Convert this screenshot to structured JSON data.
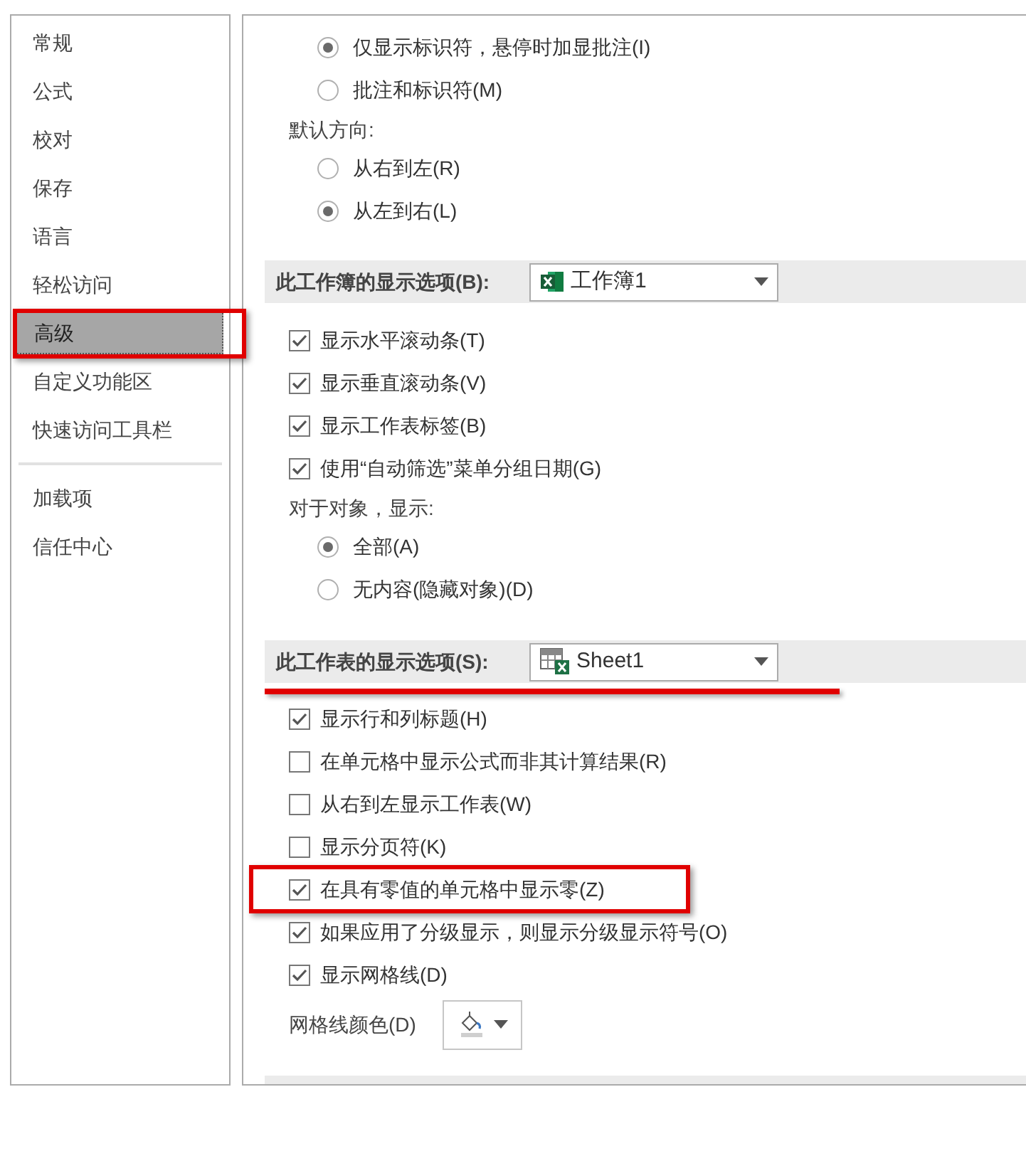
{
  "sidebar": {
    "items": [
      {
        "kind": "item",
        "label": "常规",
        "selected": false,
        "highlighted": false
      },
      {
        "kind": "item",
        "label": "公式",
        "selected": false,
        "highlighted": false
      },
      {
        "kind": "item",
        "label": "校对",
        "selected": false,
        "highlighted": false
      },
      {
        "kind": "item",
        "label": "保存",
        "selected": false,
        "highlighted": false
      },
      {
        "kind": "item",
        "label": "语言",
        "selected": false,
        "highlighted": false
      },
      {
        "kind": "item",
        "label": "轻松访问",
        "selected": false,
        "highlighted": false
      },
      {
        "kind": "item",
        "label": "高级",
        "selected": true,
        "highlighted": true
      },
      {
        "kind": "item",
        "label": "自定义功能区",
        "selected": false,
        "highlighted": false
      },
      {
        "kind": "item",
        "label": "快速访问工具栏",
        "selected": false,
        "highlighted": false
      },
      {
        "kind": "separator"
      },
      {
        "kind": "item",
        "label": "加载项",
        "selected": false,
        "highlighted": false
      },
      {
        "kind": "item",
        "label": "信任中心",
        "selected": false,
        "highlighted": false
      }
    ]
  },
  "content": [
    {
      "kind": "radio",
      "label": "仅显示标识符，悬停时加显批注(I)",
      "selected": true
    },
    {
      "kind": "radio",
      "label": "批注和标识符(M)",
      "selected": false
    },
    {
      "kind": "label",
      "label": "默认方向:"
    },
    {
      "kind": "radio",
      "label": "从右到左(R)",
      "selected": false
    },
    {
      "kind": "radio",
      "label": "从左到右(L)",
      "selected": true
    },
    {
      "kind": "section",
      "label": "此工作簿的显示选项(B):",
      "dropdown": {
        "kind": "workbook",
        "value": "工作簿1"
      },
      "highlighted": false
    },
    {
      "kind": "checkbox",
      "label": "显示水平滚动条(T)",
      "checked": true,
      "highlighted": false
    },
    {
      "kind": "checkbox",
      "label": "显示垂直滚动条(V)",
      "checked": true,
      "highlighted": false
    },
    {
      "kind": "checkbox",
      "label": "显示工作表标签(B)",
      "checked": true,
      "highlighted": false
    },
    {
      "kind": "checkbox",
      "label": "使用“自动筛选”菜单分组日期(G)",
      "checked": true,
      "highlighted": false
    },
    {
      "kind": "label",
      "label": "对于对象，显示:"
    },
    {
      "kind": "radio",
      "label": "全部(A)",
      "selected": true
    },
    {
      "kind": "radio",
      "label": "无内容(隐藏对象)(D)",
      "selected": false
    },
    {
      "kind": "section",
      "label": "此工作表的显示选项(S):",
      "dropdown": {
        "kind": "sheet",
        "value": "Sheet1"
      },
      "highlighted": true
    },
    {
      "kind": "checkbox",
      "label": "显示行和列标题(H)",
      "checked": true,
      "highlighted": false
    },
    {
      "kind": "checkbox",
      "label": "在单元格中显示公式而非其计算结果(R)",
      "checked": false,
      "highlighted": false
    },
    {
      "kind": "checkbox",
      "label": "从右到左显示工作表(W)",
      "checked": false,
      "highlighted": false
    },
    {
      "kind": "checkbox",
      "label": "显示分页符(K)",
      "checked": false,
      "highlighted": false
    },
    {
      "kind": "checkbox",
      "label": "在具有零值的单元格中显示零(Z)",
      "checked": true,
      "highlighted": true
    },
    {
      "kind": "checkbox",
      "label": "如果应用了分级显示，则显示分级显示符号(O)",
      "checked": true,
      "highlighted": false
    },
    {
      "kind": "checkbox",
      "label": "显示网格线(D)",
      "checked": true,
      "highlighted": false
    },
    {
      "kind": "color_picker",
      "label": "网格线颜色(D)"
    }
  ]
}
